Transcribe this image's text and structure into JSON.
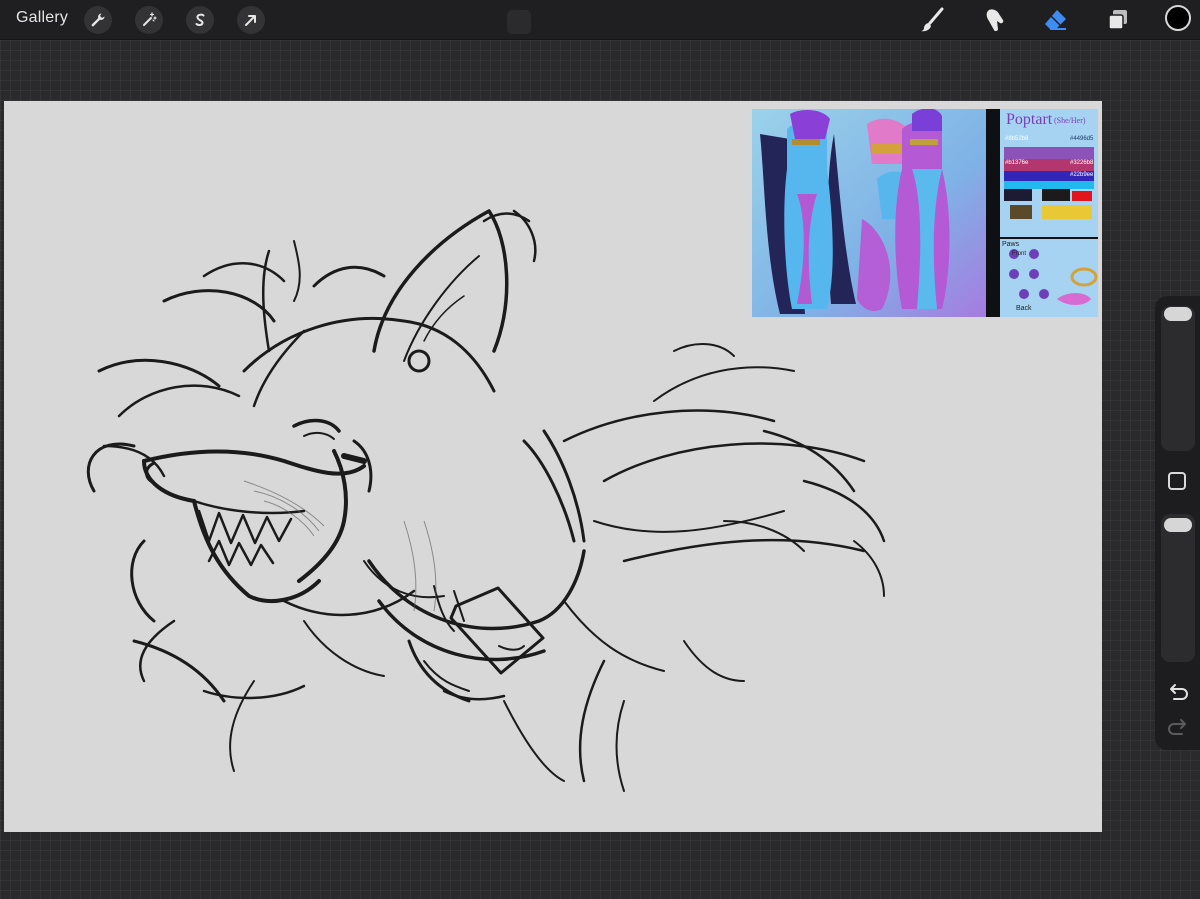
{
  "topbar": {
    "gallery_label": "Gallery",
    "left_tools": [
      {
        "icon": "wrench-icon",
        "name": "actions"
      },
      {
        "icon": "magic-wand-icon",
        "name": "adjustments"
      },
      {
        "icon": "selection-s-icon",
        "name": "selection"
      },
      {
        "icon": "arrow-cursor-icon",
        "name": "transform"
      }
    ],
    "right_tools": [
      {
        "icon": "brush-icon",
        "name": "brush"
      },
      {
        "icon": "smudge-icon",
        "name": "smudge"
      },
      {
        "icon": "eraser-icon",
        "name": "eraser",
        "active": true
      },
      {
        "icon": "layers-icon",
        "name": "layers"
      }
    ],
    "current_color": "#000000",
    "active_tool_color": "#3d8df5"
  },
  "reference": {
    "title": "Poptart",
    "pronouns": "(She/Her)",
    "hex_codes": [
      "#8b52b8",
      "#4496d5",
      "#b1376e",
      "#3226b8",
      "#22b9ee"
    ],
    "paws_label": "Paws",
    "front_label": "Front",
    "back_label": "Back"
  },
  "sidebar": {
    "brush_size_level": 0.02,
    "opacity_level": 0.02,
    "undo_icon": "undo-arrow-icon",
    "redo_icon": "redo-arrow-icon"
  }
}
